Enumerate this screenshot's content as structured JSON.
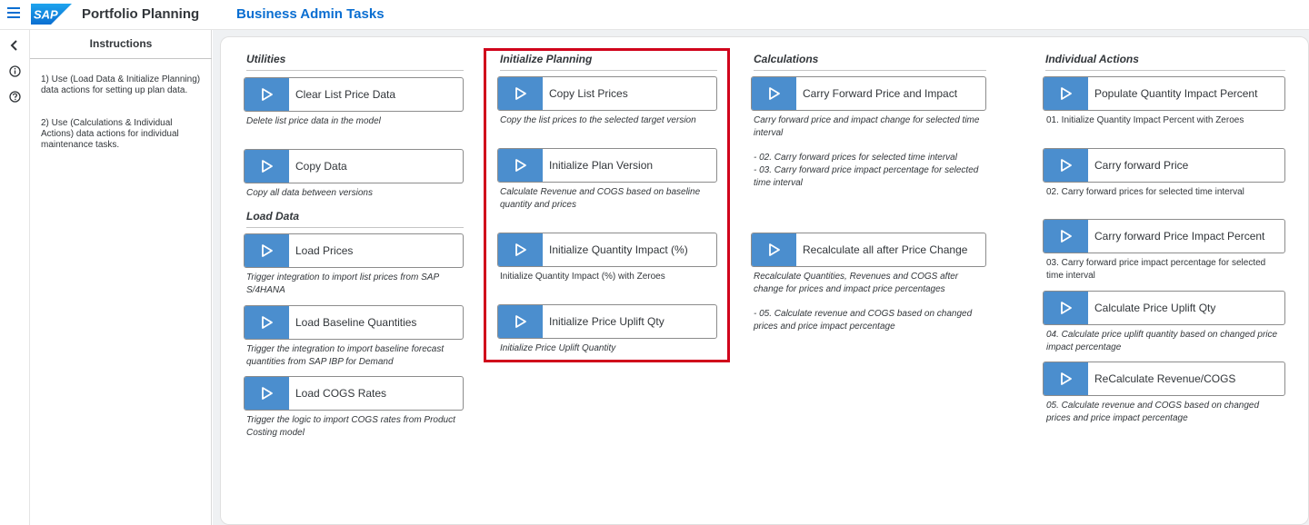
{
  "shell": {
    "app_title": "Portfolio Planning",
    "page_title": "Business Admin Tasks",
    "logo_text": "SAP"
  },
  "colors": {
    "accent": "#0a6ed1",
    "play_button": "#4b8ece",
    "highlight": "#d0021b"
  },
  "instructions": {
    "title": "Instructions",
    "paragraphs": [
      "1) Use (Load Data & Initialize Planning) data actions for setting up plan data.",
      "2) Use (Calculations & Individual Actions) data actions for individual maintenance tasks."
    ]
  },
  "sections": {
    "utilities": "Utilities",
    "load_data": "Load Data",
    "initialize_planning": "Initialize Planning",
    "calculations": "Calculations",
    "individual_actions": "Individual Actions"
  },
  "utilities": [
    {
      "label": "Clear List Price Data",
      "desc": "Delete list price data in the model"
    },
    {
      "label": "Copy Data",
      "desc": "Copy all data between versions"
    }
  ],
  "load_data": [
    {
      "label": "Load Prices",
      "desc": "Trigger integration to import list prices from SAP S/4HANA"
    },
    {
      "label": "Load Baseline Quantities",
      "desc": "Trigger the integration to import baseline forecast quantities from SAP IBP for Demand"
    },
    {
      "label": "Load COGS Rates",
      "desc": "Trigger the logic to import COGS rates from Product Costing model"
    }
  ],
  "initialize_planning": [
    {
      "label": "Copy List Prices",
      "desc": "Copy the list prices to the selected target version"
    },
    {
      "label": "Initialize Plan Version",
      "desc": "Calculate Revenue and COGS based on baseline quantity and prices"
    },
    {
      "label": "Initialize Quantity Impact (%)",
      "desc": "Initialize Quantity Impact (%) with Zeroes"
    },
    {
      "label": "Initialize Price Uplift Qty",
      "desc": "Initialize Price Uplift Quantity"
    }
  ],
  "calculations": [
    {
      "label": "Carry Forward Price and Impact",
      "desc": "Carry forward price and impact change for selected time interval",
      "desc2": "- 02. Carry forward prices for selected time interval",
      "desc3": "- 03. Carry forward price impact percentage for selected time interval"
    },
    {
      "label": "Recalculate all after Price Change",
      "desc": "Recalculate Quantities, Revenues and COGS after change for prices and impact price percentages",
      "desc2": "- 05. Calculate revenue and COGS based on changed prices and price impact percentage"
    }
  ],
  "individual_actions": [
    {
      "label": "Populate Quantity Impact Percent",
      "desc": "01. Initialize Quantity Impact Percent with Zeroes"
    },
    {
      "label": "Carry forward Price",
      "desc": "02. Carry forward prices for selected time interval"
    },
    {
      "label": "Carry forward Price Impact Percent",
      "desc": "03. Carry forward price impact percentage for selected time interval"
    },
    {
      "label": "Calculate Price Uplift Qty",
      "desc": "04. Calculate price uplift quantity based on changed price impact percentage"
    },
    {
      "label": "ReCalculate Revenue/COGS",
      "desc": "05. Calculate revenue and COGS based on changed prices and price impact percentage"
    }
  ]
}
